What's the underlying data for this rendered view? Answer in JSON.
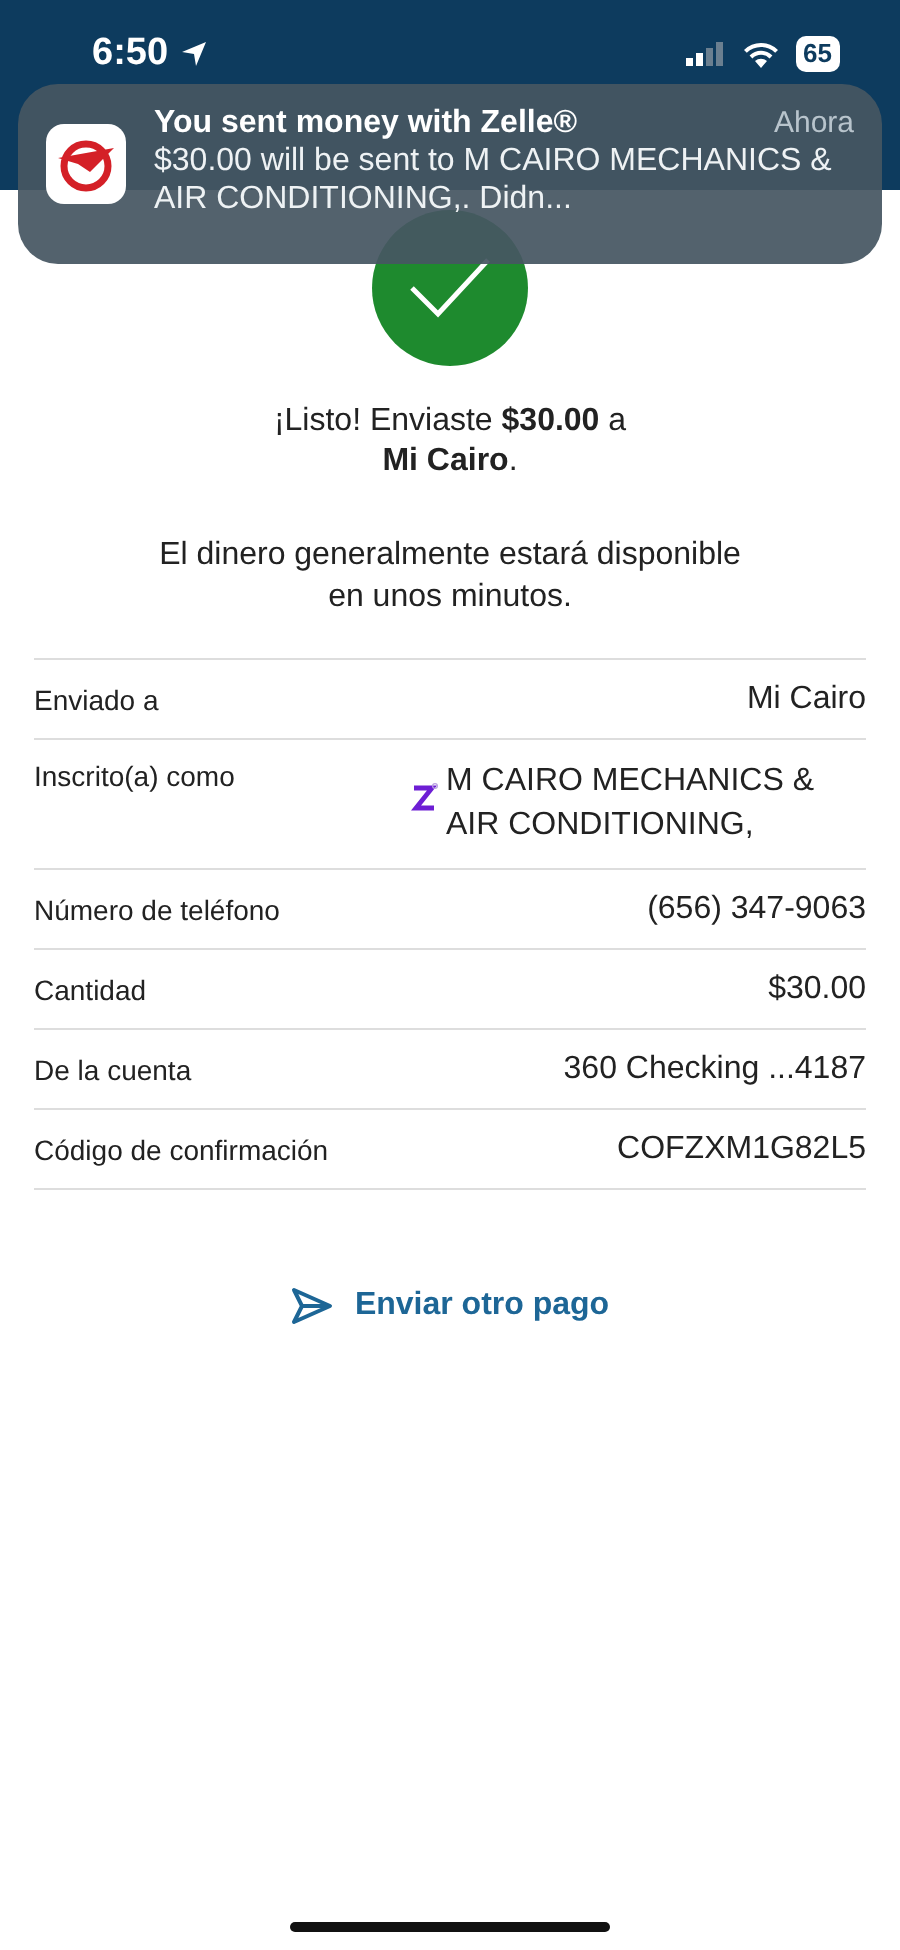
{
  "status_bar": {
    "time": "6:50",
    "battery": "65"
  },
  "notification": {
    "title": "You sent money with Zelle®",
    "time": "Ahora",
    "body": "$30.00 will be sent to M CAIRO MECHANICS & AIR CONDITIONING,. Didn..."
  },
  "confirmation": {
    "message": "¡Listo! Enviaste **$30.00** a\n**Mi Cairo**.",
    "note": "El dinero generalmente estará disponible\nen unos minutos."
  },
  "details": [
    {
      "label": "Enviado a",
      "value": "Mi Cairo",
      "kind": "plain"
    },
    {
      "label": "Inscrito(a) como",
      "value": "M CAIRO MECHANICS & AIR CONDITIONING,",
      "kind": "zelle"
    },
    {
      "label": "Número de teléfono",
      "value": "(656) 347-9063",
      "kind": "plain"
    },
    {
      "label": "Cantidad",
      "value": "$30.00",
      "kind": "plain"
    },
    {
      "label": "De la cuenta",
      "value": "360 Checking ...4187",
      "kind": "plain"
    },
    {
      "label": "Código de confirmación",
      "value": "COFZXM1G82L5",
      "kind": "plain"
    }
  ],
  "action": {
    "label": "Enviar otro pago"
  }
}
